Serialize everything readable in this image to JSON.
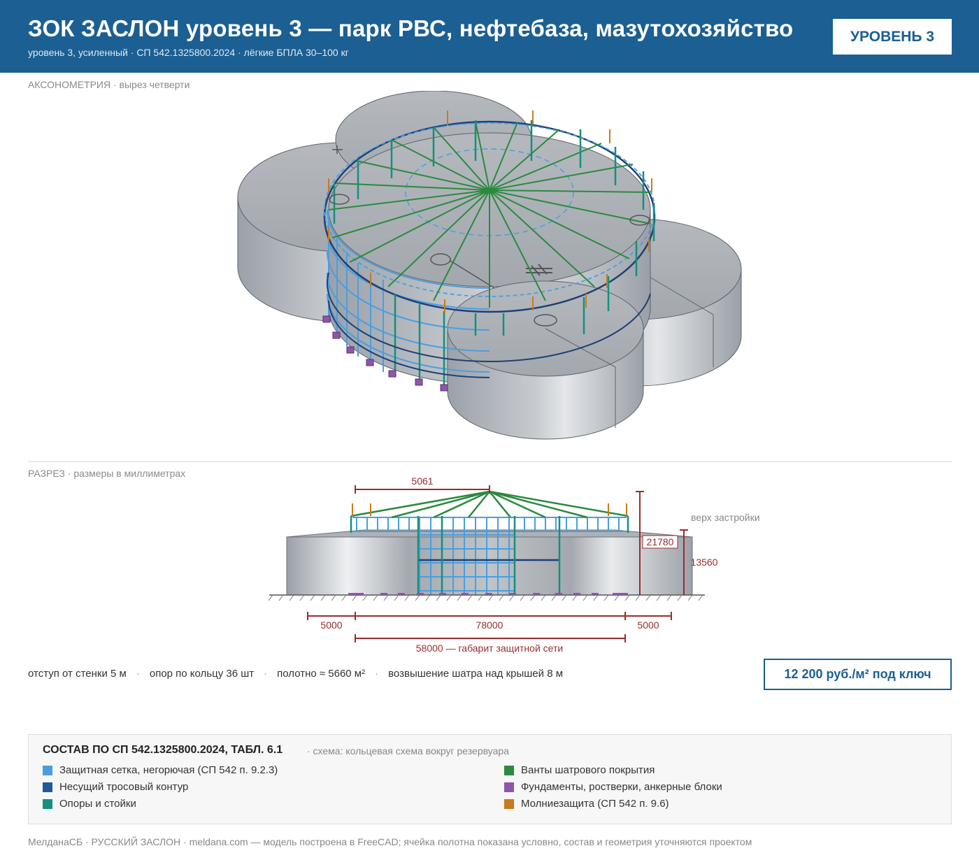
{
  "header": {
    "title": "ЗОК ЗАСЛОН уровень 3 — парк РВС, нефтебаза, мазутохозяйство",
    "subtitle": "уровень 3, усиленный · СП 542.1325800.2024 · лёгкие БПЛА 30–100 кг",
    "badge": "УРОВЕНЬ 3"
  },
  "axon": {
    "label": "АКСОНОМЕТРИЯ",
    "note": " · вырез четверти"
  },
  "section": {
    "label": "РАЗРЕЗ",
    "note": " · размеры в миллиметрах",
    "dims": {
      "top_span": "5061",
      "left_offset": "5000",
      "tank": "78000",
      "right_offset": "5000",
      "net_span": "58000 — габарит защитной сети",
      "total_height": "21780",
      "build_height": "13560",
      "build_label": "верх застройки"
    }
  },
  "stats": {
    "items": [
      "отступ от стенки 5 м",
      "опор по кольцу 36 шт",
      "полотно ≈ 5660 м²",
      "возвышение шатра над крышей 8 м"
    ],
    "separator": "·"
  },
  "price": "12 200 руб./м² под ключ",
  "legend": {
    "title": "СОСТАВ ПО СП 542.1325800.2024, ТАБЛ. 6.1",
    "scheme": "· схема: кольцевая схема вокруг резервуара",
    "items": [
      {
        "label": "Защитная сетка, негорючая (СП 542 п. 9.2.3)",
        "color": "#4a9ee0"
      },
      {
        "label": "Несущий тросовый контур",
        "color": "#1f5a99"
      },
      {
        "label": "Опоры и стойки",
        "color": "#14907c"
      },
      {
        "label": "Ванты шатрового покрытия",
        "color": "#2a8a3e"
      },
      {
        "label": "Фундаменты, ростверки, анкерные блоки",
        "color": "#8e56a8"
      },
      {
        "label": "Молниезащита (СП 542 п. 9.6)",
        "color": "#c97a1e"
      }
    ]
  },
  "footer": "МелданаСБ · РУССКИЙ ЗАСЛОН · meldana.com — модель построена в FreeCAD; ячейка полотна показана условно, состав и геометрия уточняются проектом",
  "colors": {
    "brand": "#1b5f93",
    "dimension": "#9b2c2c",
    "tank": "#a8adb3"
  }
}
